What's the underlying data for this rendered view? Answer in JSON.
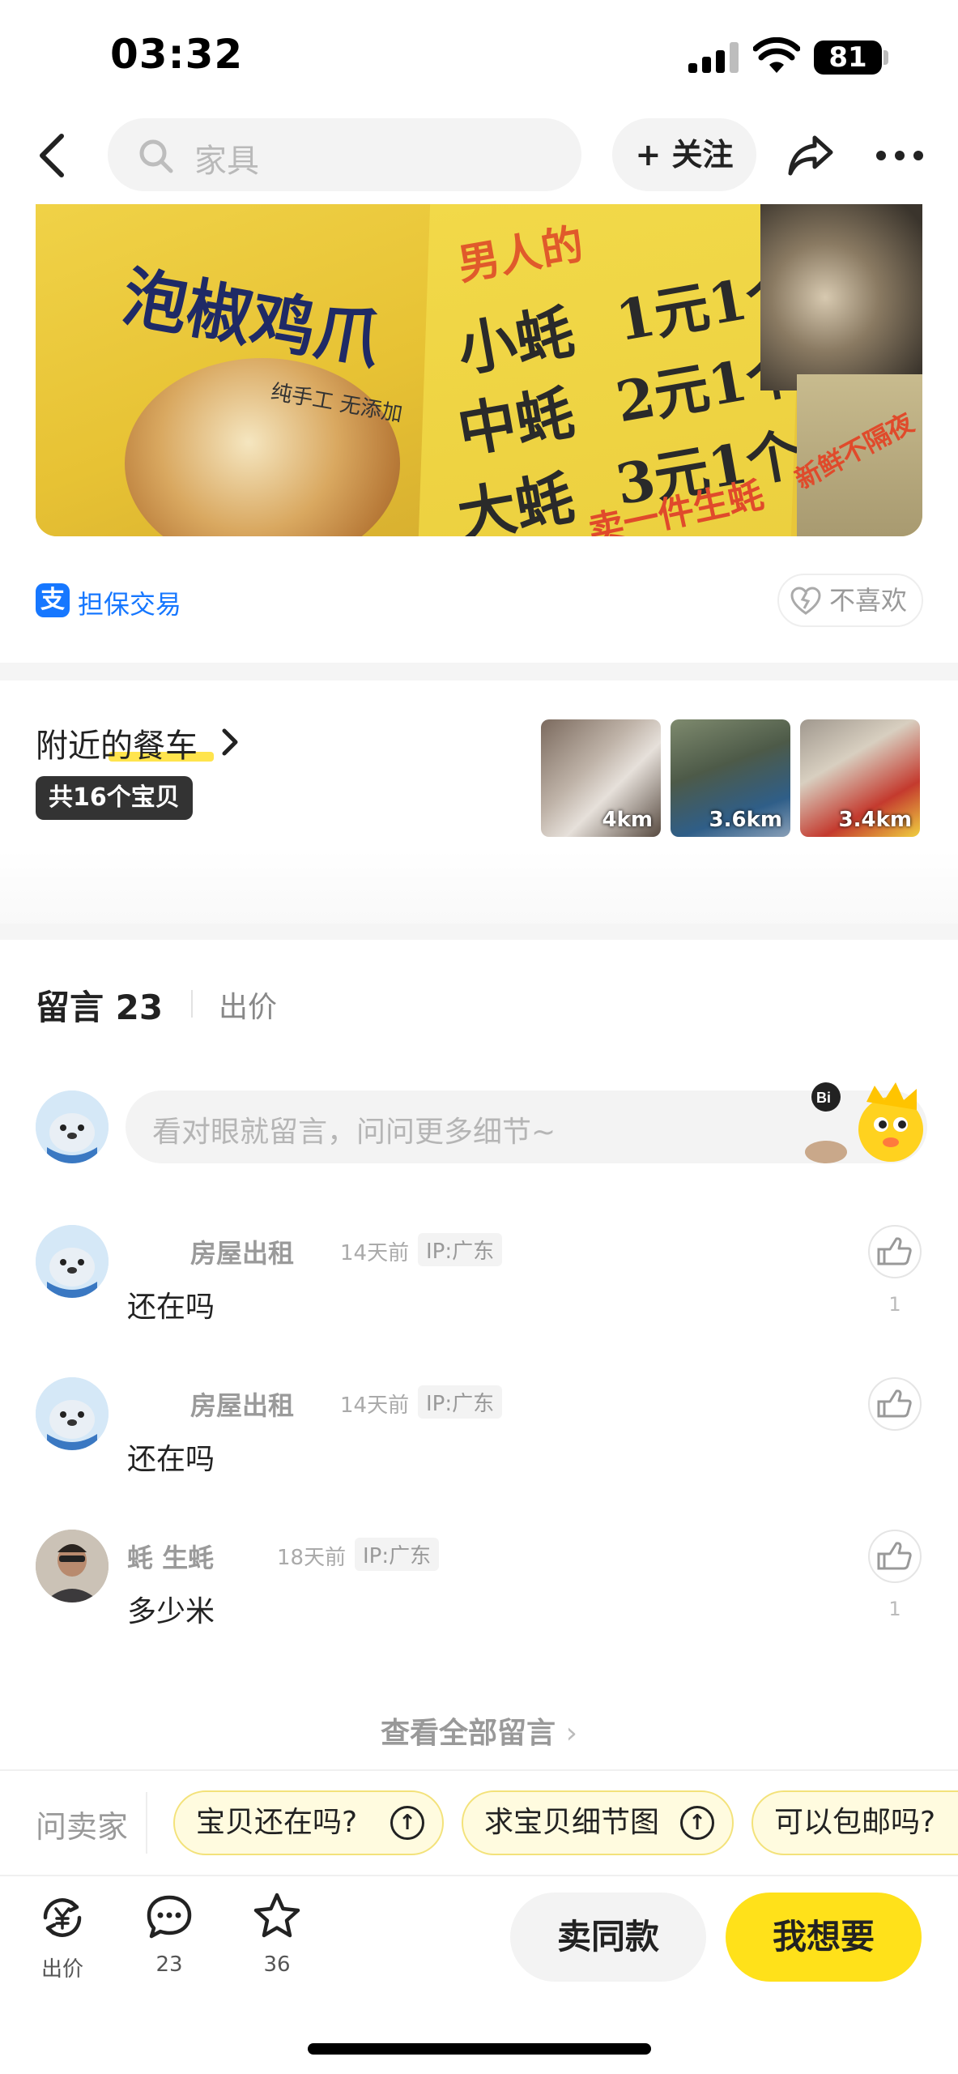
{
  "status_bar": {
    "time": "03:32",
    "battery": "81"
  },
  "nav": {
    "search_placeholder": "家具",
    "follow_label": "+ 关注"
  },
  "hero": {
    "left_title": "泡椒鸡爪",
    "left_sub": "纯手工 无添加",
    "board_head": "男人的",
    "prices": [
      {
        "name": "小蚝",
        "price": "1元1个"
      },
      {
        "name": "中蚝",
        "price": "2元1个"
      },
      {
        "name": "大蚝",
        "price": "3元1个"
      }
    ],
    "board_foot": "卖一件生蚝",
    "side_text": "新鲜不隔夜"
  },
  "guarantee": {
    "icon": "支",
    "label": "担保交易",
    "dislike": "不喜欢"
  },
  "nearby": {
    "title": "附近的餐车",
    "count": "共16个宝贝",
    "thumbs": [
      {
        "distance": "4km"
      },
      {
        "distance": "3.6km"
      },
      {
        "distance": "3.4km"
      }
    ]
  },
  "comments": {
    "title": "留言 23",
    "bid_tab": "出价",
    "input_placeholder": "看对眼就留言，问问更多细节~",
    "items": [
      {
        "name": "房屋出租",
        "time": "14天前",
        "ip": "IP:广东",
        "text": "还在吗",
        "likes": "1"
      },
      {
        "name": "房屋出租",
        "time": "14天前",
        "ip": "IP:广东",
        "text": "还在吗",
        "likes": ""
      },
      {
        "name": "蚝 生蚝",
        "time": "18天前",
        "ip": "IP:广东",
        "text": "多少米",
        "likes": "1"
      }
    ],
    "view_all": "查看全部留言"
  },
  "quick_ask": {
    "label": "问卖家",
    "chips": [
      "宝贝还在吗?",
      "求宝贝细节图",
      "可以包邮吗?"
    ]
  },
  "bottom_bar": {
    "bid_label": "出价",
    "comment_count": "23",
    "fav_count": "36",
    "same_button": "卖同款",
    "want_button": "我想要"
  },
  "colors": {
    "accent_yellow": "#ffe11a",
    "alipay_blue": "#1677ff"
  }
}
